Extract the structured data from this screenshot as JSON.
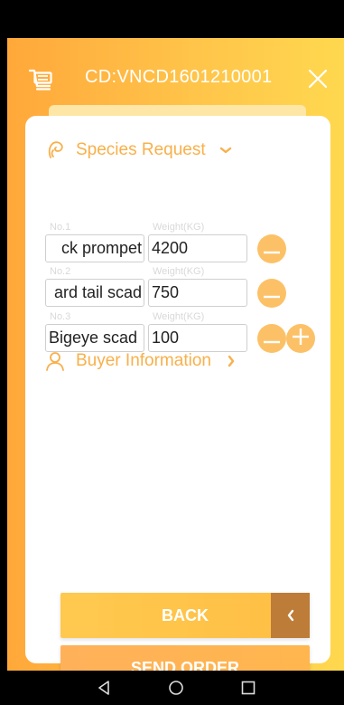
{
  "header": {
    "order_code": "CD:VNCD1601210001",
    "cart_icon": "cart-icon",
    "close_icon": "close-icon"
  },
  "species_section": {
    "title": "Species Request",
    "icon": "species-icon",
    "expanded": true,
    "rows": [
      {
        "no_label": "No.1",
        "weight_label": "Weight(KG)",
        "species": "ck prompet",
        "weight": "4200",
        "actions": [
          "remove"
        ]
      },
      {
        "no_label": "No.2",
        "weight_label": "Weight(KG)",
        "species": "ard tail scad",
        "weight": "750",
        "actions": [
          "remove"
        ]
      },
      {
        "no_label": "No.3",
        "weight_label": "Weight(KG)",
        "species": "Bigeye scad",
        "weight": "100",
        "actions": [
          "remove",
          "add"
        ]
      }
    ]
  },
  "buyer_section": {
    "title": "Buyer Information",
    "icon": "person-icon",
    "expanded": false
  },
  "buttons": {
    "back_label": "BACK",
    "send_label": "SEND ORDER"
  },
  "colors": {
    "accent": "#f8b04a",
    "gradient_start": "#ffa83a",
    "gradient_end": "#ffd84f",
    "circle_button": "#fcc167",
    "back_chevron_box": "#bd7c38"
  }
}
